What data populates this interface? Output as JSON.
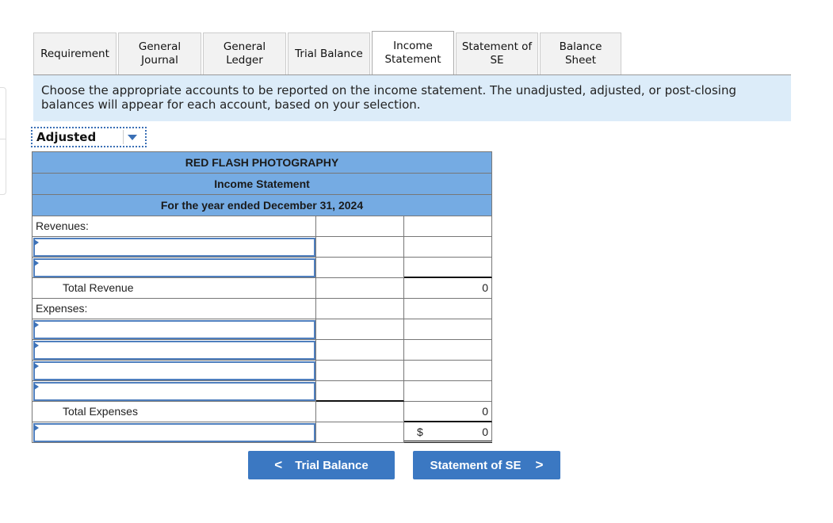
{
  "tabs": [
    {
      "label": "Requirement",
      "active": false
    },
    {
      "label": "General Journal",
      "active": false
    },
    {
      "label": "General Ledger",
      "active": false
    },
    {
      "label": "Trial Balance",
      "active": false
    },
    {
      "label": "Income Statement",
      "active": true
    },
    {
      "label": "Statement of SE",
      "active": false
    },
    {
      "label": "Balance Sheet",
      "active": false
    }
  ],
  "instruction": "Choose the appropriate accounts to be reported on the income statement. The unadjusted, adjusted, or post-closing balances will appear for each account, based on your selection.",
  "balance_select": {
    "value": "Adjusted",
    "icon": "caret-down-icon"
  },
  "statement": {
    "company": "RED FLASH PHOTOGRAPHY",
    "title": "Income Statement",
    "period": "For the year ended December 31, 2024",
    "revenues_label": "Revenues:",
    "revenue_inputs": [
      "",
      ""
    ],
    "total_revenue_label": "Total Revenue",
    "total_revenue_value": "0",
    "expenses_label": "Expenses:",
    "expense_inputs": [
      "",
      "",
      "",
      ""
    ],
    "total_expenses_label": "Total Expenses",
    "total_expenses_value": "0",
    "net_label_input": "",
    "net_currency": "$",
    "net_value": "0"
  },
  "nav": {
    "prev_label": "Trial Balance",
    "prev_icon": "chevron-left-icon",
    "next_label": "Statement of SE",
    "next_icon": "chevron-right-icon"
  }
}
